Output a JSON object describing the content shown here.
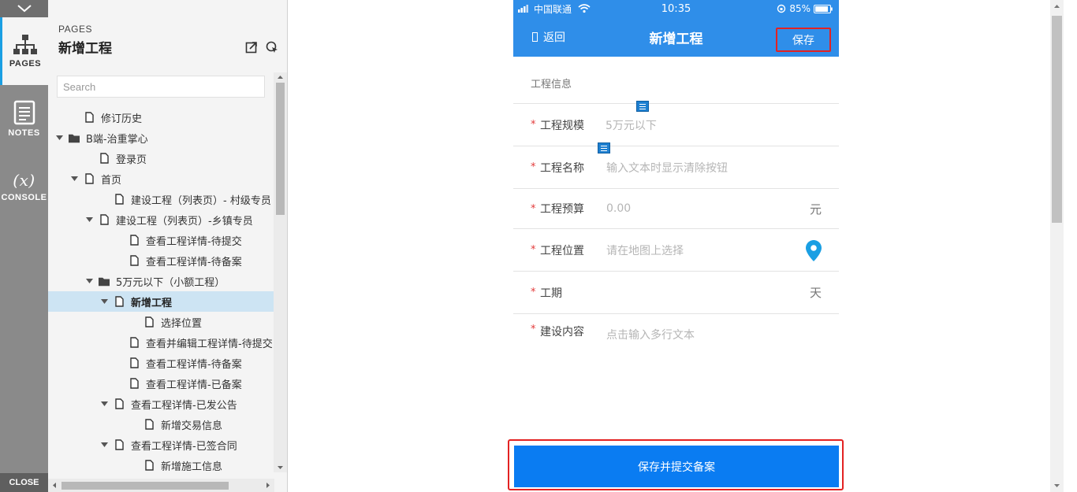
{
  "rail": {
    "tabs": [
      {
        "label": "PAGES",
        "icon": "sitemap-icon",
        "active": true
      },
      {
        "label": "NOTES",
        "icon": "notes-icon",
        "active": false
      },
      {
        "label": "CONSOLE",
        "icon": "variable-icon",
        "active": false
      }
    ],
    "close_label": "CLOSE"
  },
  "panel": {
    "kicker": "PAGES",
    "title": "新增工程",
    "search_placeholder": "Search",
    "tree": [
      {
        "label": "修订历史",
        "level": 1,
        "type": "page",
        "caret": "none"
      },
      {
        "label": "B端-治重掌心",
        "level": 0,
        "type": "folder",
        "caret": "down"
      },
      {
        "label": "登录页",
        "level": 2,
        "type": "page",
        "caret": "none"
      },
      {
        "label": "首页",
        "level": 1,
        "type": "page",
        "caret": "down"
      },
      {
        "label": "建设工程（列表页）- 村级专员",
        "level": 3,
        "type": "page",
        "caret": "none"
      },
      {
        "label": "建设工程（列表页）-乡镇专员",
        "level": 2,
        "type": "page",
        "caret": "down"
      },
      {
        "label": "查看工程详情-待提交",
        "level": 4,
        "type": "page",
        "caret": "none"
      },
      {
        "label": "查看工程详情-待备案",
        "level": 4,
        "type": "page",
        "caret": "none"
      },
      {
        "label": "5万元以下（小额工程）",
        "level": 2,
        "type": "folder",
        "caret": "down"
      },
      {
        "label": "新增工程",
        "level": 3,
        "type": "page",
        "caret": "down",
        "selected": true
      },
      {
        "label": "选择位置",
        "level": 5,
        "type": "page",
        "caret": "none"
      },
      {
        "label": "查看并编辑工程详情-待提交",
        "level": 4,
        "type": "page",
        "caret": "none"
      },
      {
        "label": "查看工程详情-待备案",
        "level": 4,
        "type": "page",
        "caret": "none"
      },
      {
        "label": "查看工程详情-已备案",
        "level": 4,
        "type": "page",
        "caret": "none"
      },
      {
        "label": "查看工程详情-已发公告",
        "level": 3,
        "type": "page",
        "caret": "down"
      },
      {
        "label": "新增交易信息",
        "level": 5,
        "type": "page",
        "caret": "none"
      },
      {
        "label": "查看工程详情-已签合同",
        "level": 3,
        "type": "page",
        "caret": "down"
      },
      {
        "label": "新增施工信息",
        "level": 5,
        "type": "page",
        "caret": "none"
      }
    ]
  },
  "phone": {
    "status": {
      "carrier": "中国联通",
      "time": "10:35",
      "battery": "85%"
    },
    "nav": {
      "back": "返回",
      "title": "新增工程",
      "save": "保存"
    },
    "section_header": "工程信息",
    "fields": [
      {
        "label": "工程规模",
        "value": "5万元以下",
        "unit": "",
        "required": true
      },
      {
        "label": "工程名称",
        "value": "输入文本时显示清除按钮",
        "unit": "",
        "required": true
      },
      {
        "label": "工程预算",
        "value": "0.00",
        "unit": "元",
        "required": true
      },
      {
        "label": "工程位置",
        "value": "请在地图上选择",
        "unit": "",
        "required": true,
        "pin": true
      },
      {
        "label": "工期",
        "value": "",
        "unit": "天",
        "required": true
      },
      {
        "label": "建设内容",
        "value": "点击输入多行文本",
        "unit": "",
        "required": true
      }
    ],
    "submit_label": "保存并提交备案",
    "accent": "#2f8ee9",
    "button_color": "#0a7cf2",
    "highlight": "#e32222"
  }
}
